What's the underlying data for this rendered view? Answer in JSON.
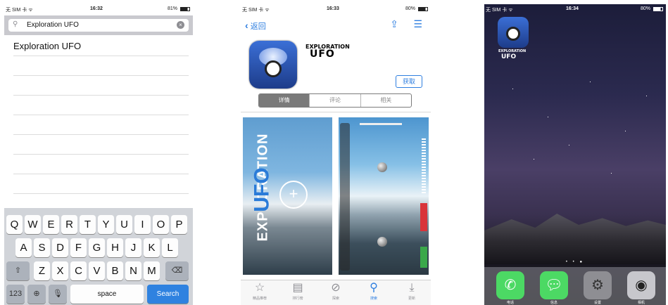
{
  "phone1": {
    "status": {
      "carrier": "无 SIM 卡 ᯤ",
      "time": "16:32",
      "battery": "81%"
    },
    "search": {
      "value": "Exploration UFO",
      "clear_icon": "clear-icon"
    },
    "result": "Exploration UFO",
    "keyboard": {
      "row1": [
        "Q",
        "W",
        "E",
        "R",
        "T",
        "Y",
        "U",
        "I",
        "O",
        "P"
      ],
      "row2": [
        "A",
        "S",
        "D",
        "F",
        "G",
        "H",
        "J",
        "K",
        "L"
      ],
      "row3": [
        "Z",
        "X",
        "C",
        "V",
        "B",
        "N",
        "M"
      ],
      "numbers": "123",
      "space": "space",
      "search": "Search"
    }
  },
  "phone2": {
    "status": {
      "carrier": "无 SIM 卡 ᯤ",
      "time": "16:33",
      "battery": "80%"
    },
    "back": "返回",
    "app_logo_line1": "EXPLORATION",
    "app_logo_line2": "UFO",
    "get_button": "获取",
    "segments": [
      "详情",
      "评论",
      "相关"
    ],
    "screenshot_text1": "EXPLORATION",
    "screenshot_text2": "UFO",
    "tabs": [
      {
        "icon": "star-icon",
        "label": "精品推荐"
      },
      {
        "icon": "list-icon",
        "label": "排行榜"
      },
      {
        "icon": "compass-icon",
        "label": "探索"
      },
      {
        "icon": "search-icon",
        "label": "搜索"
      },
      {
        "icon": "download-icon",
        "label": "更新"
      }
    ]
  },
  "phone3": {
    "status": {
      "carrier": "无 SIM 卡 ᯤ",
      "time": "16:34",
      "battery": "80%"
    },
    "app_label_line1": "EXPLORATION",
    "app_label_line2": "UFO",
    "dock": [
      {
        "icon": "phone-icon",
        "label": "电话",
        "color": "#4cd964"
      },
      {
        "icon": "messages-icon",
        "label": "信息",
        "color": "#4cd964"
      },
      {
        "icon": "settings-icon",
        "label": "设置",
        "color": "#8e8e93"
      },
      {
        "icon": "camera-icon",
        "label": "相机",
        "color": "#c7c7cc"
      }
    ]
  }
}
